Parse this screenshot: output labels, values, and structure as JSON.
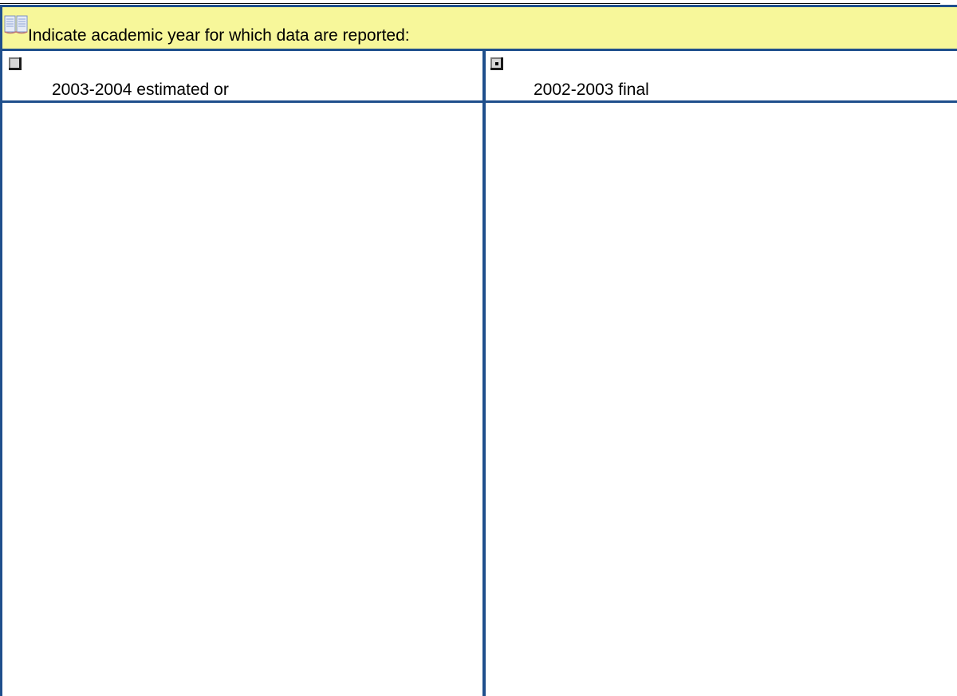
{
  "header": {
    "icon": "book-icon",
    "prompt": "Indicate academic year for which data are reported:",
    "background_color": "#f7f79a",
    "border_color": "#1f4f8c"
  },
  "options": [
    {
      "label": "2003-2004 estimated or",
      "selected": false
    },
    {
      "label": "2002-2003 final",
      "selected": true
    }
  ]
}
